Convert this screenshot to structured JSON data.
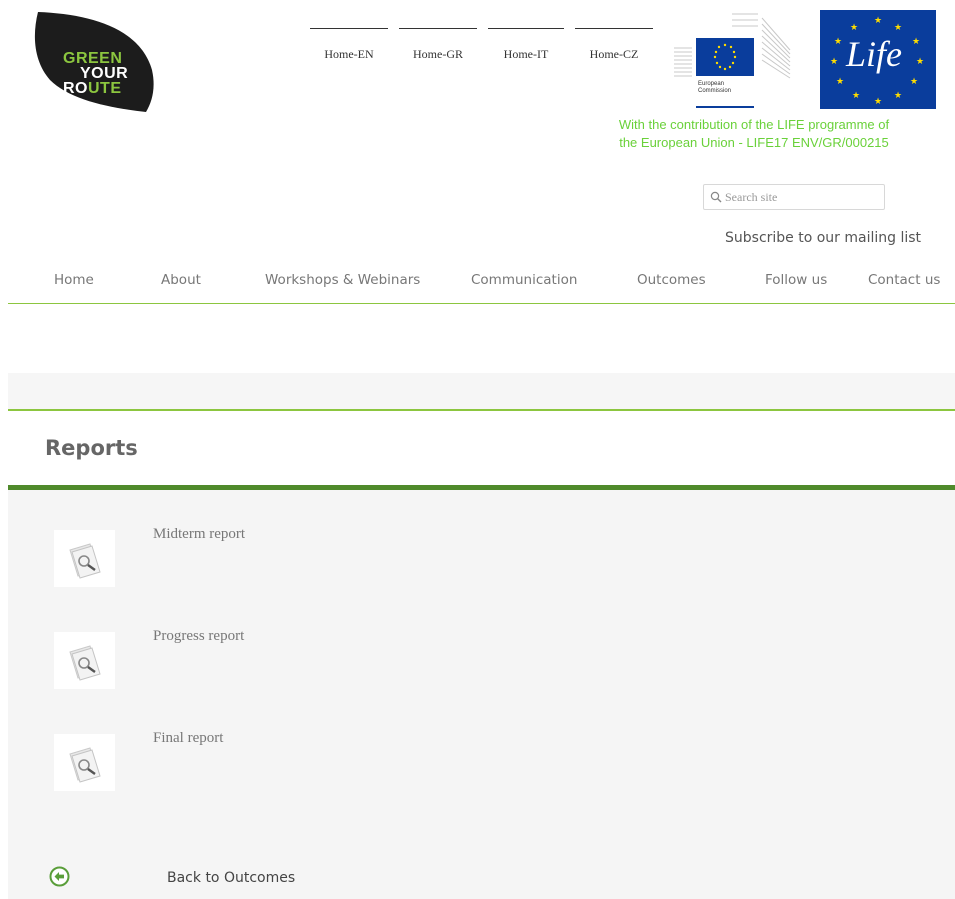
{
  "header": {
    "logo": {
      "line1": "GREEN",
      "line2": "YOUR",
      "line3_pre": "RO",
      "line3_hl": "UTE"
    },
    "language_links": [
      "Home-EN",
      "Home-GR",
      "Home-IT",
      "Home-CZ"
    ],
    "ec_logo": {
      "caption_line1": "European",
      "caption_line2": "Commission"
    },
    "life_logo": {
      "text": "Life"
    },
    "contribution_line1": "With the contribution of the LIFE programme of",
    "contribution_line2": "the European Union - LIFE17 ENV/GR/000215",
    "search": {
      "placeholder": "Search site"
    },
    "subscribe_label": "Subscribe to our mailing list"
  },
  "nav": {
    "items": [
      "Home",
      "About",
      "Workshops & Webinars",
      "Communication",
      "Outcomes",
      "Follow us",
      "Contact us"
    ]
  },
  "main": {
    "title": "Reports",
    "reports": [
      "Midterm report",
      "Progress report",
      "Final report"
    ],
    "back_label": "Back to Outcomes"
  },
  "colors": {
    "brand_green": "#8cc63f",
    "dark_green": "#4f8a2b",
    "contribution_green": "#6ad13a",
    "eu_blue": "#0a3d9c",
    "star_yellow": "#ffdd00"
  },
  "icons": {
    "report": "magnifier-document-icon",
    "back": "back-arrow-icon",
    "search": "search-icon"
  }
}
